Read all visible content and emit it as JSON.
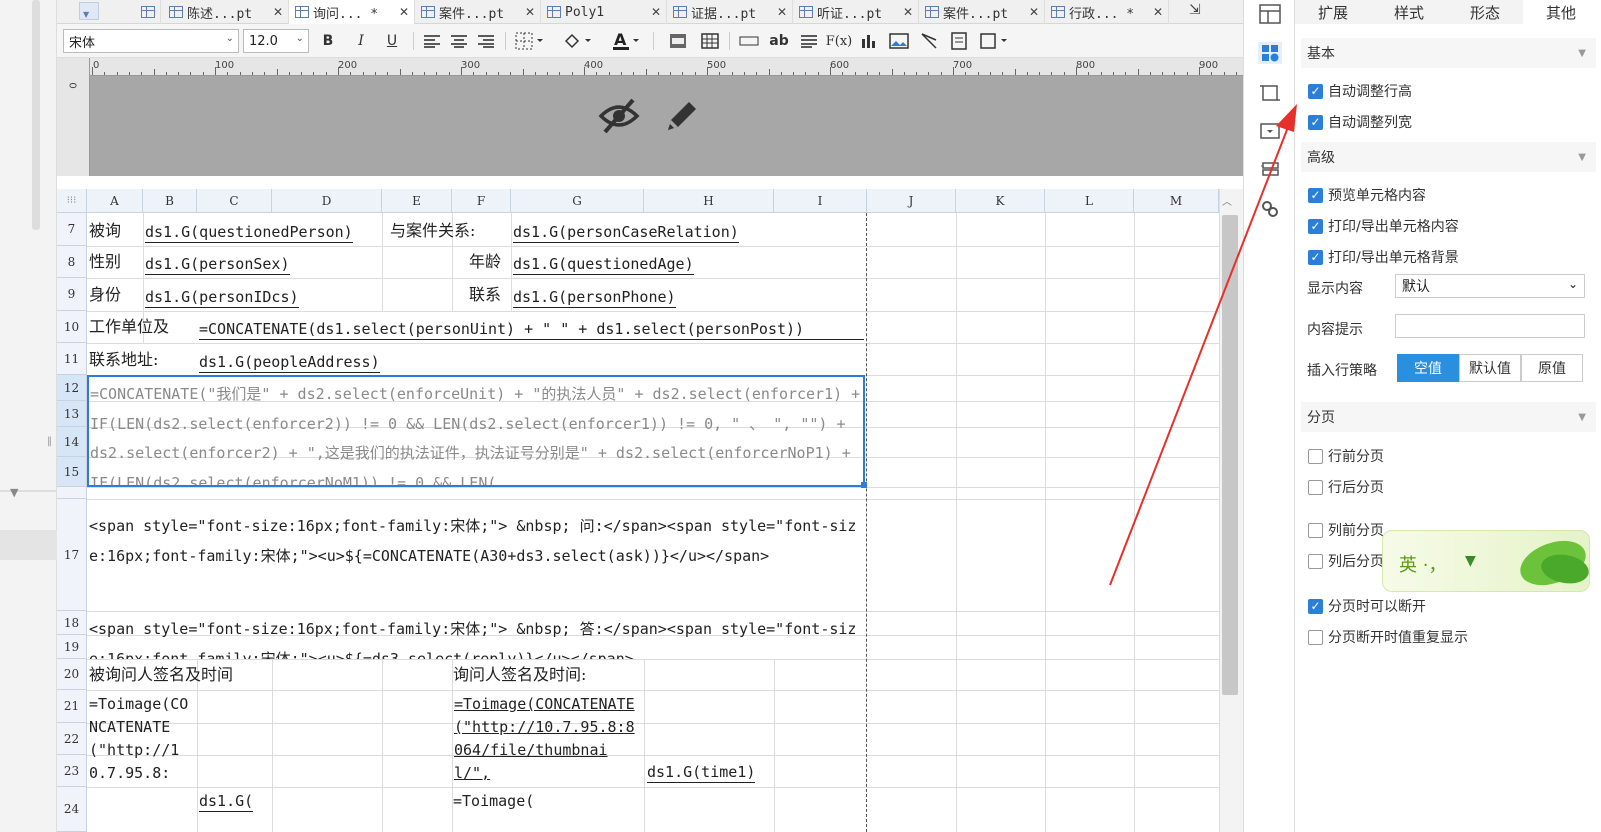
{
  "tabs": [
    {
      "label": "陈述...pt",
      "close": "✕"
    },
    {
      "label": "询问...  *",
      "close": "✕"
    },
    {
      "label": "案件...pt",
      "close": "✕"
    },
    {
      "label": "Poly1",
      "close": "✕"
    },
    {
      "label": "证据...pt",
      "close": "✕"
    },
    {
      "label": "听证...pt",
      "close": "✕"
    },
    {
      "label": "案件...pt",
      "close": "✕"
    },
    {
      "label": "行政...  *",
      "close": "✕"
    }
  ],
  "toolbar": {
    "font_name": "宋体",
    "font_size": "12.0",
    "bold": "B",
    "italic": "I",
    "underline": "U",
    "text_ab": "ab",
    "formula": "F(x)"
  },
  "ruler": {
    "top_labels": [
      "0",
      "100",
      "200",
      "300",
      "400",
      "500",
      "600",
      "700",
      "800",
      "900"
    ],
    "left_label": "0"
  },
  "grid": {
    "corner": "⁝⁝⁝",
    "columns": [
      "A",
      "B",
      "C",
      "D",
      "E",
      "F",
      "G",
      "H",
      "I",
      "J",
      "K",
      "L",
      "M"
    ],
    "rows": [
      "7",
      "8",
      "9",
      "10",
      "11",
      "12",
      "13",
      "14",
      "15",
      "17",
      "18",
      "19",
      "20",
      "21",
      "22",
      "23",
      "24"
    ],
    "cells": {
      "r7_a": "被询",
      "r7_b": "ds1.G(questionedPerson)",
      "r7_e": "与案件关系:",
      "r7_g": "ds1.G(personCaseRelation)",
      "r8_a": "性别",
      "r8_b": "ds1.G(personSex)",
      "r8_f": "年龄",
      "r8_g": "ds1.G(questionedAge)",
      "r9_a": "身份",
      "r9_b": "ds1.G(personIDcs)",
      "r9_f": "联系",
      "r9_g": "ds1.G(personPhone)",
      "r10_a": "工作单位及",
      "r10_c": "=CONCATENATE(ds1.select(personUint) + \"  \" + ds1.select(personPost))",
      "r11_a": "联系地址:",
      "r11_c": "ds1.G(peopleAddress)",
      "r12_text": "=CONCATENATE(\"我们是\" + ds2.select(enforceUnit) + \"的执法人员\" + ds2.select(enforcer1) + IF(LEN(ds2.select(enforcer2)) != 0 && LEN(ds2.select(enforcer1)) != 0, \" 、 \", \"\") + ds2.select(enforcer2) + \",这是我们的执法证件，执法证号分别是\" + ds2.select(enforcerNoP1) + IF(LEN(ds2.select(enforcerNoM1)) != 0 && LEN(",
      "r17_text": "<span style=\"font-size:16px;font-family:宋体;\"> &nbsp; 问:</span><span style=\"font-size:16px;font-family:宋体;\"><u>${=CONCATENATE(A30+ds3.select(ask))}</u></span>",
      "r18_text": "<span style=\"font-size:16px;font-family:宋体;\"> &nbsp; 答:</span><span style=\"font-size:16px;font-family:宋体;\"><u>${=ds3.select(reply)}</u></span>",
      "r20_a": "被询问人签名及时间",
      "r20_f": "询问人签名及时间:",
      "r21_a": "=Toimage(CONCATENATE(\"http://10.7.95.8:",
      "r21_f": "=Toimage(CONCATENATE(\"http://10.7.95.8:8064/file/thumbnail/\",",
      "r23_h": "ds1.G(time1)",
      "r24_c": "ds1.G(",
      "r24_f": "=Toimage("
    }
  },
  "panel": {
    "tabs": [
      "扩展",
      "样式",
      "形态",
      "其他"
    ],
    "active_tab": "其他",
    "sections": {
      "basic": "基本",
      "advanced": "高级",
      "paging": "分页"
    },
    "basic_checks": [
      {
        "label": "自动调整行高",
        "checked": true
      },
      {
        "label": "自动调整列宽",
        "checked": true
      }
    ],
    "advanced_checks": [
      {
        "label": "预览单元格内容",
        "checked": true
      },
      {
        "label": "打印/导出单元格内容",
        "checked": true
      },
      {
        "label": "打印/导出单元格背景",
        "checked": true
      }
    ],
    "display_label": "显示内容",
    "display_value": "默认",
    "hint_label": "内容提示",
    "hint_value": "",
    "insert_label": "插入行策略",
    "insert_options": [
      "空值",
      "默认值",
      "原值"
    ],
    "insert_selected": "空值",
    "paging_checks": [
      {
        "label": "行前分页",
        "checked": false
      },
      {
        "label": "行后分页",
        "checked": false
      },
      {
        "label": "列前分页",
        "checked": false
      },
      {
        "label": "列后分页",
        "checked": false
      },
      {
        "label": "分页时可以断开",
        "checked": true
      },
      {
        "label": "分页断开时值重复显示",
        "checked": false
      }
    ]
  },
  "ime": {
    "text": "英 ·，"
  },
  "colors": {
    "accent": "#2b8fe0",
    "checkbox": "#2b7fd8",
    "arrow": "#e8302a",
    "selection": "#2d7be0"
  }
}
